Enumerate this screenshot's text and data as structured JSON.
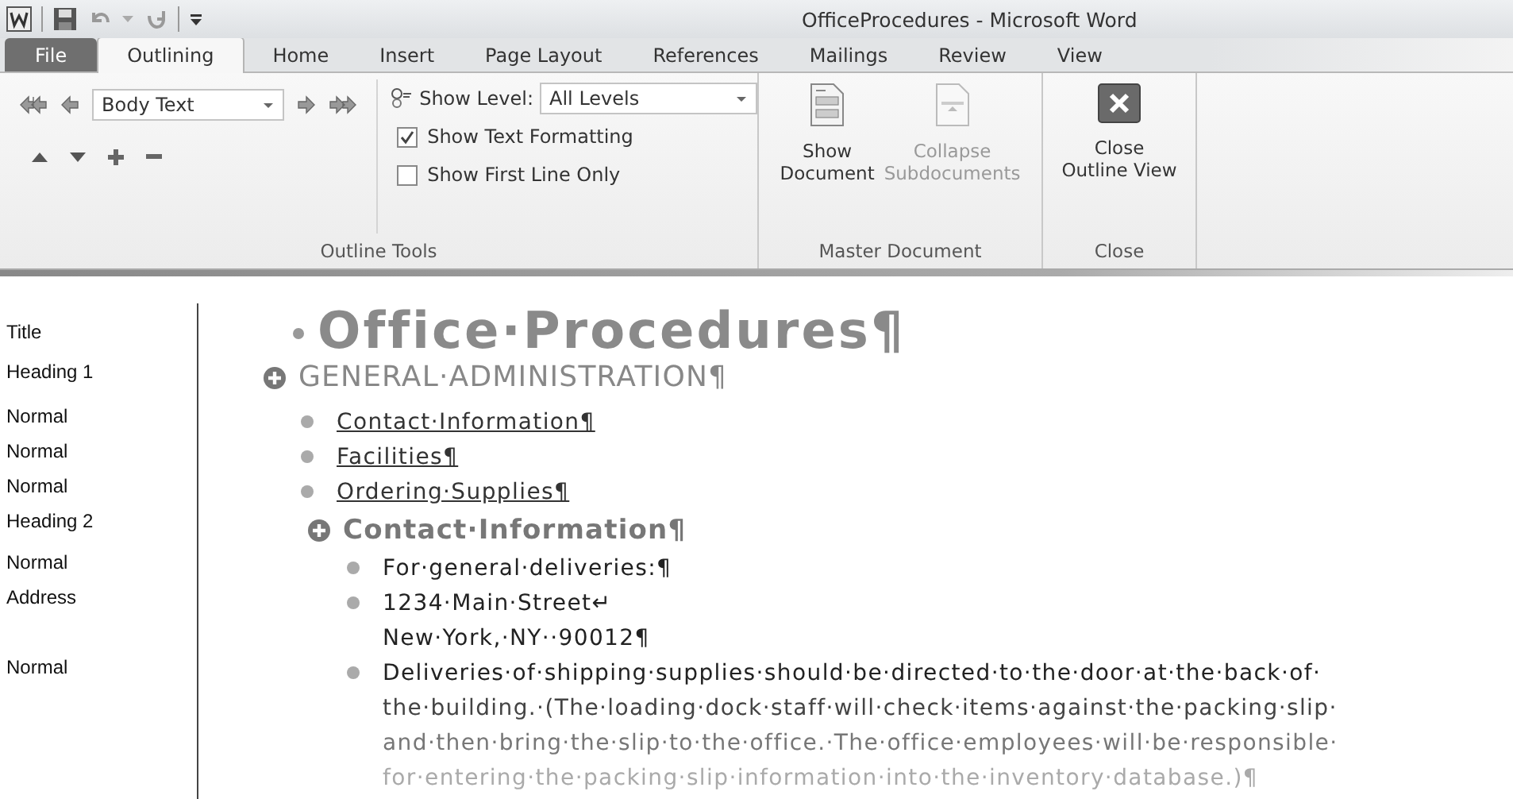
{
  "window": {
    "title": "OfficeProcedures  -  Microsoft Word"
  },
  "tabs": [
    {
      "label": "File",
      "kind": "file",
      "selected": false
    },
    {
      "label": "Outlining",
      "kind": "tab",
      "selected": true
    },
    {
      "label": "Home",
      "kind": "tab",
      "selected": false
    },
    {
      "label": "Insert",
      "kind": "tab",
      "selected": false
    },
    {
      "label": "Page Layout",
      "kind": "tab",
      "selected": false
    },
    {
      "label": "References",
      "kind": "tab",
      "selected": false
    },
    {
      "label": "Mailings",
      "kind": "tab",
      "selected": false
    },
    {
      "label": "Review",
      "kind": "tab",
      "selected": false
    },
    {
      "label": "View",
      "kind": "tab",
      "selected": false
    }
  ],
  "outline_tools": {
    "level_box": "Body Text",
    "show_level": {
      "label": "Show Level:",
      "value": "All Levels"
    },
    "checkboxes": [
      {
        "label": "Show Text Formatting",
        "checked": true
      },
      {
        "label": "Show First Line Only",
        "checked": false
      }
    ],
    "group_label": "Outline Tools"
  },
  "master_document": {
    "buttons": [
      {
        "lines": [
          "Show",
          "Document"
        ],
        "disabled": false
      },
      {
        "lines": [
          "Collapse",
          "Subdocuments"
        ],
        "disabled": true
      }
    ],
    "group_label": "Master Document"
  },
  "close_group": {
    "button": {
      "lines": [
        "Close",
        "Outline View"
      ]
    },
    "group_label": "Close"
  },
  "document": [
    {
      "style": "Title",
      "kind": "title",
      "underlined": false,
      "lines": [
        "Office·Procedures¶"
      ]
    },
    {
      "style": "Heading 1",
      "kind": "heading1",
      "underlined": false,
      "lines": [
        "GENERAL·ADMINISTRATION¶"
      ]
    },
    {
      "style": "Normal",
      "kind": "item",
      "underlined": true,
      "lines": [
        "Contact·Information¶"
      ]
    },
    {
      "style": "Normal",
      "kind": "item",
      "underlined": true,
      "lines": [
        "Facilities¶"
      ]
    },
    {
      "style": "Normal",
      "kind": "item",
      "underlined": true,
      "lines": [
        "Ordering·Supplies¶"
      ]
    },
    {
      "style": "Heading 2",
      "kind": "heading2",
      "underlined": false,
      "lines": [
        "Contact·Information¶"
      ]
    },
    {
      "style": "Normal",
      "kind": "body",
      "underlined": false,
      "lines": [
        "For·general·deliveries:¶"
      ]
    },
    {
      "style": "Address",
      "kind": "body",
      "underlined": false,
      "lines": [
        "1234·Main·Street↵",
        "New·York,·NY··90012¶"
      ]
    },
    {
      "style": "Normal",
      "kind": "body",
      "underlined": false,
      "lines": [
        "Deliveries·of·shipping·supplies·should·be·directed·to·the·door·at·the·back·of·",
        "the·building.·(The·loading·dock·staff·will·check·items·against·the·packing·slip·",
        "and·then·bring·the·slip·to·the·office.·The·office·employees·will·be·responsible·",
        "for·entering·the·packing·slip·information·into·the·inventory·database.)¶"
      ]
    }
  ]
}
